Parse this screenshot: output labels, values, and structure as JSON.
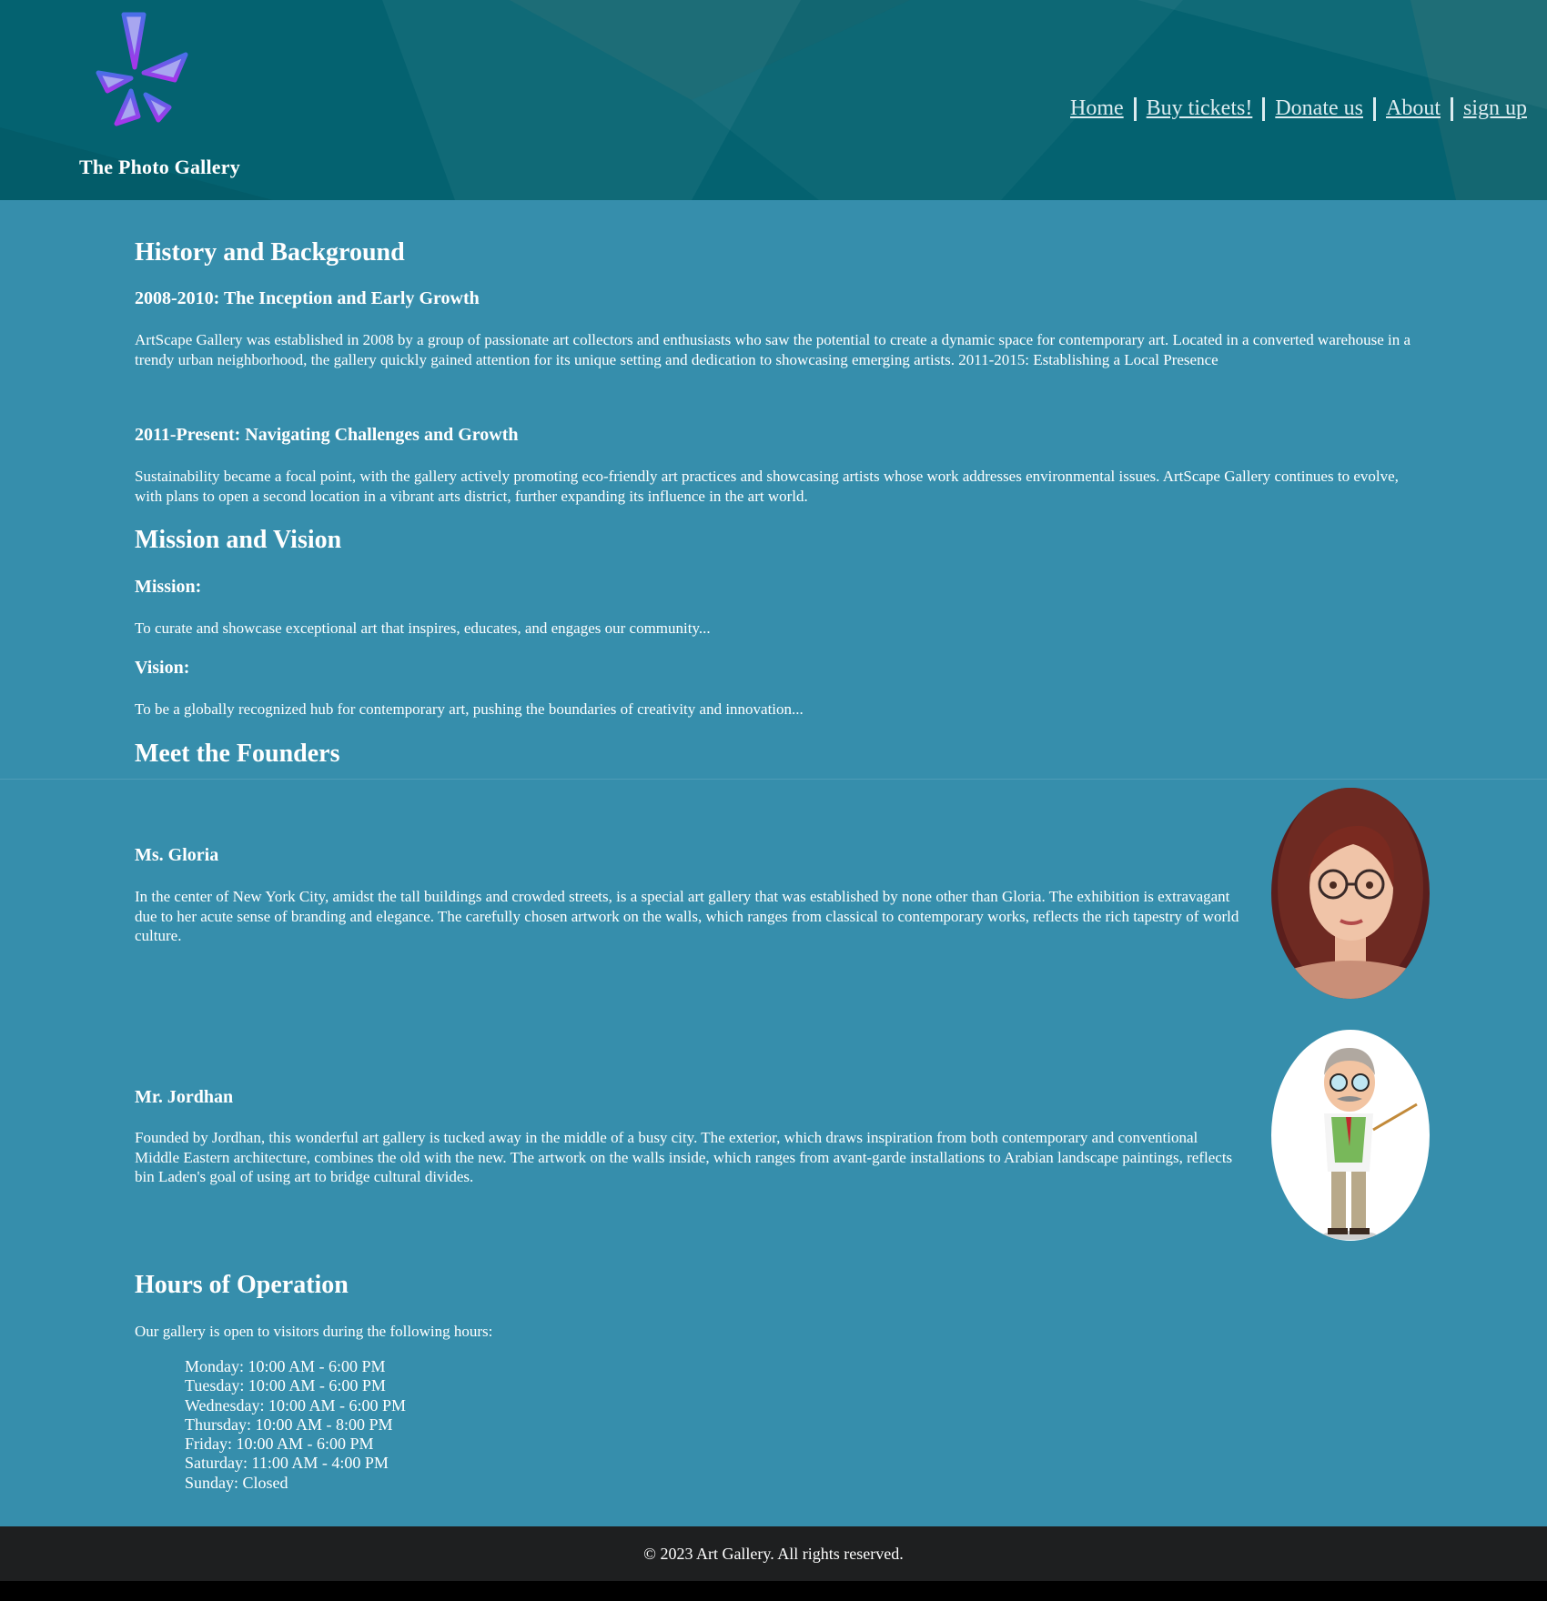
{
  "header": {
    "site_title": "The Photo Gallery",
    "nav": {
      "home": "Home",
      "buy_tickets": "Buy tickets!",
      "donate": "Donate us",
      "about": "About",
      "signup": "sign up"
    }
  },
  "history": {
    "heading": "History and Background",
    "period1_title": "2008-2010: The Inception and Early Growth",
    "period1_text": "ArtScape Gallery was established in 2008 by a group of passionate art collectors and enthusiasts who saw the potential to create a dynamic space for contemporary art. Located in a converted warehouse in a trendy urban neighborhood, the gallery quickly gained attention for its unique setting and dedication to showcasing emerging artists. 2011-2015: Establishing a Local Presence",
    "period2_title": "2011-Present: Navigating Challenges and Growth",
    "period2_text": "Sustainability became a focal point, with the gallery actively promoting eco-friendly art practices and showcasing artists whose work addresses environmental issues. ArtScape Gallery continues to evolve, with plans to open a second location in a vibrant arts district, further expanding its influence in the art world."
  },
  "mission": {
    "heading": "Mission and Vision",
    "mission_label": "Mission:",
    "mission_text": "To curate and showcase exceptional art that inspires, educates, and engages our community...",
    "vision_label": "Vision:",
    "vision_text": "To be a globally recognized hub for contemporary art, pushing the boundaries of creativity and innovation..."
  },
  "founders": {
    "heading": "Meet the Founders",
    "list": [
      {
        "name": "Ms. Gloria",
        "bio": "In the center of New York City, amidst the tall buildings and crowded streets, is a special art gallery that was established by none other than Gloria. The exhibition is extravagant due to her acute sense of branding and elegance. The carefully chosen artwork on the walls, which ranges from classical to contemporary works, reflects the rich tapestry of world culture."
      },
      {
        "name": "Mr. Jordhan",
        "bio": "Founded by Jordhan, this wonderful art gallery is tucked away in the middle of a busy city. The exterior, which draws inspiration from both contemporary and conventional Middle Eastern architecture, combines the old with the new. The artwork on the walls inside, which ranges from avant-garde installations to Arabian landscape paintings, reflects bin Laden's goal of using art to bridge cultural divides."
      }
    ]
  },
  "hours": {
    "heading": "Hours of Operation",
    "intro": "Our gallery is open to visitors during the following hours:",
    "days": [
      "Monday: 10:00 AM - 6:00 PM",
      "Tuesday: 10:00 AM - 6:00 PM",
      "Wednesday: 10:00 AM - 6:00 PM",
      "Thursday: 10:00 AM - 8:00 PM",
      "Friday: 10:00 AM - 6:00 PM",
      "Saturday: 11:00 AM - 4:00 PM",
      "Sunday: Closed"
    ]
  },
  "footer": {
    "copyright": "© 2023 Art Gallery. All rights reserved."
  },
  "colors": {
    "header_bg": "#046270",
    "main_bg": "#368eac",
    "footer_bg": "#1e1f20",
    "nav_link": "#dcecf0",
    "logo_stroke": "#6a35f0"
  }
}
